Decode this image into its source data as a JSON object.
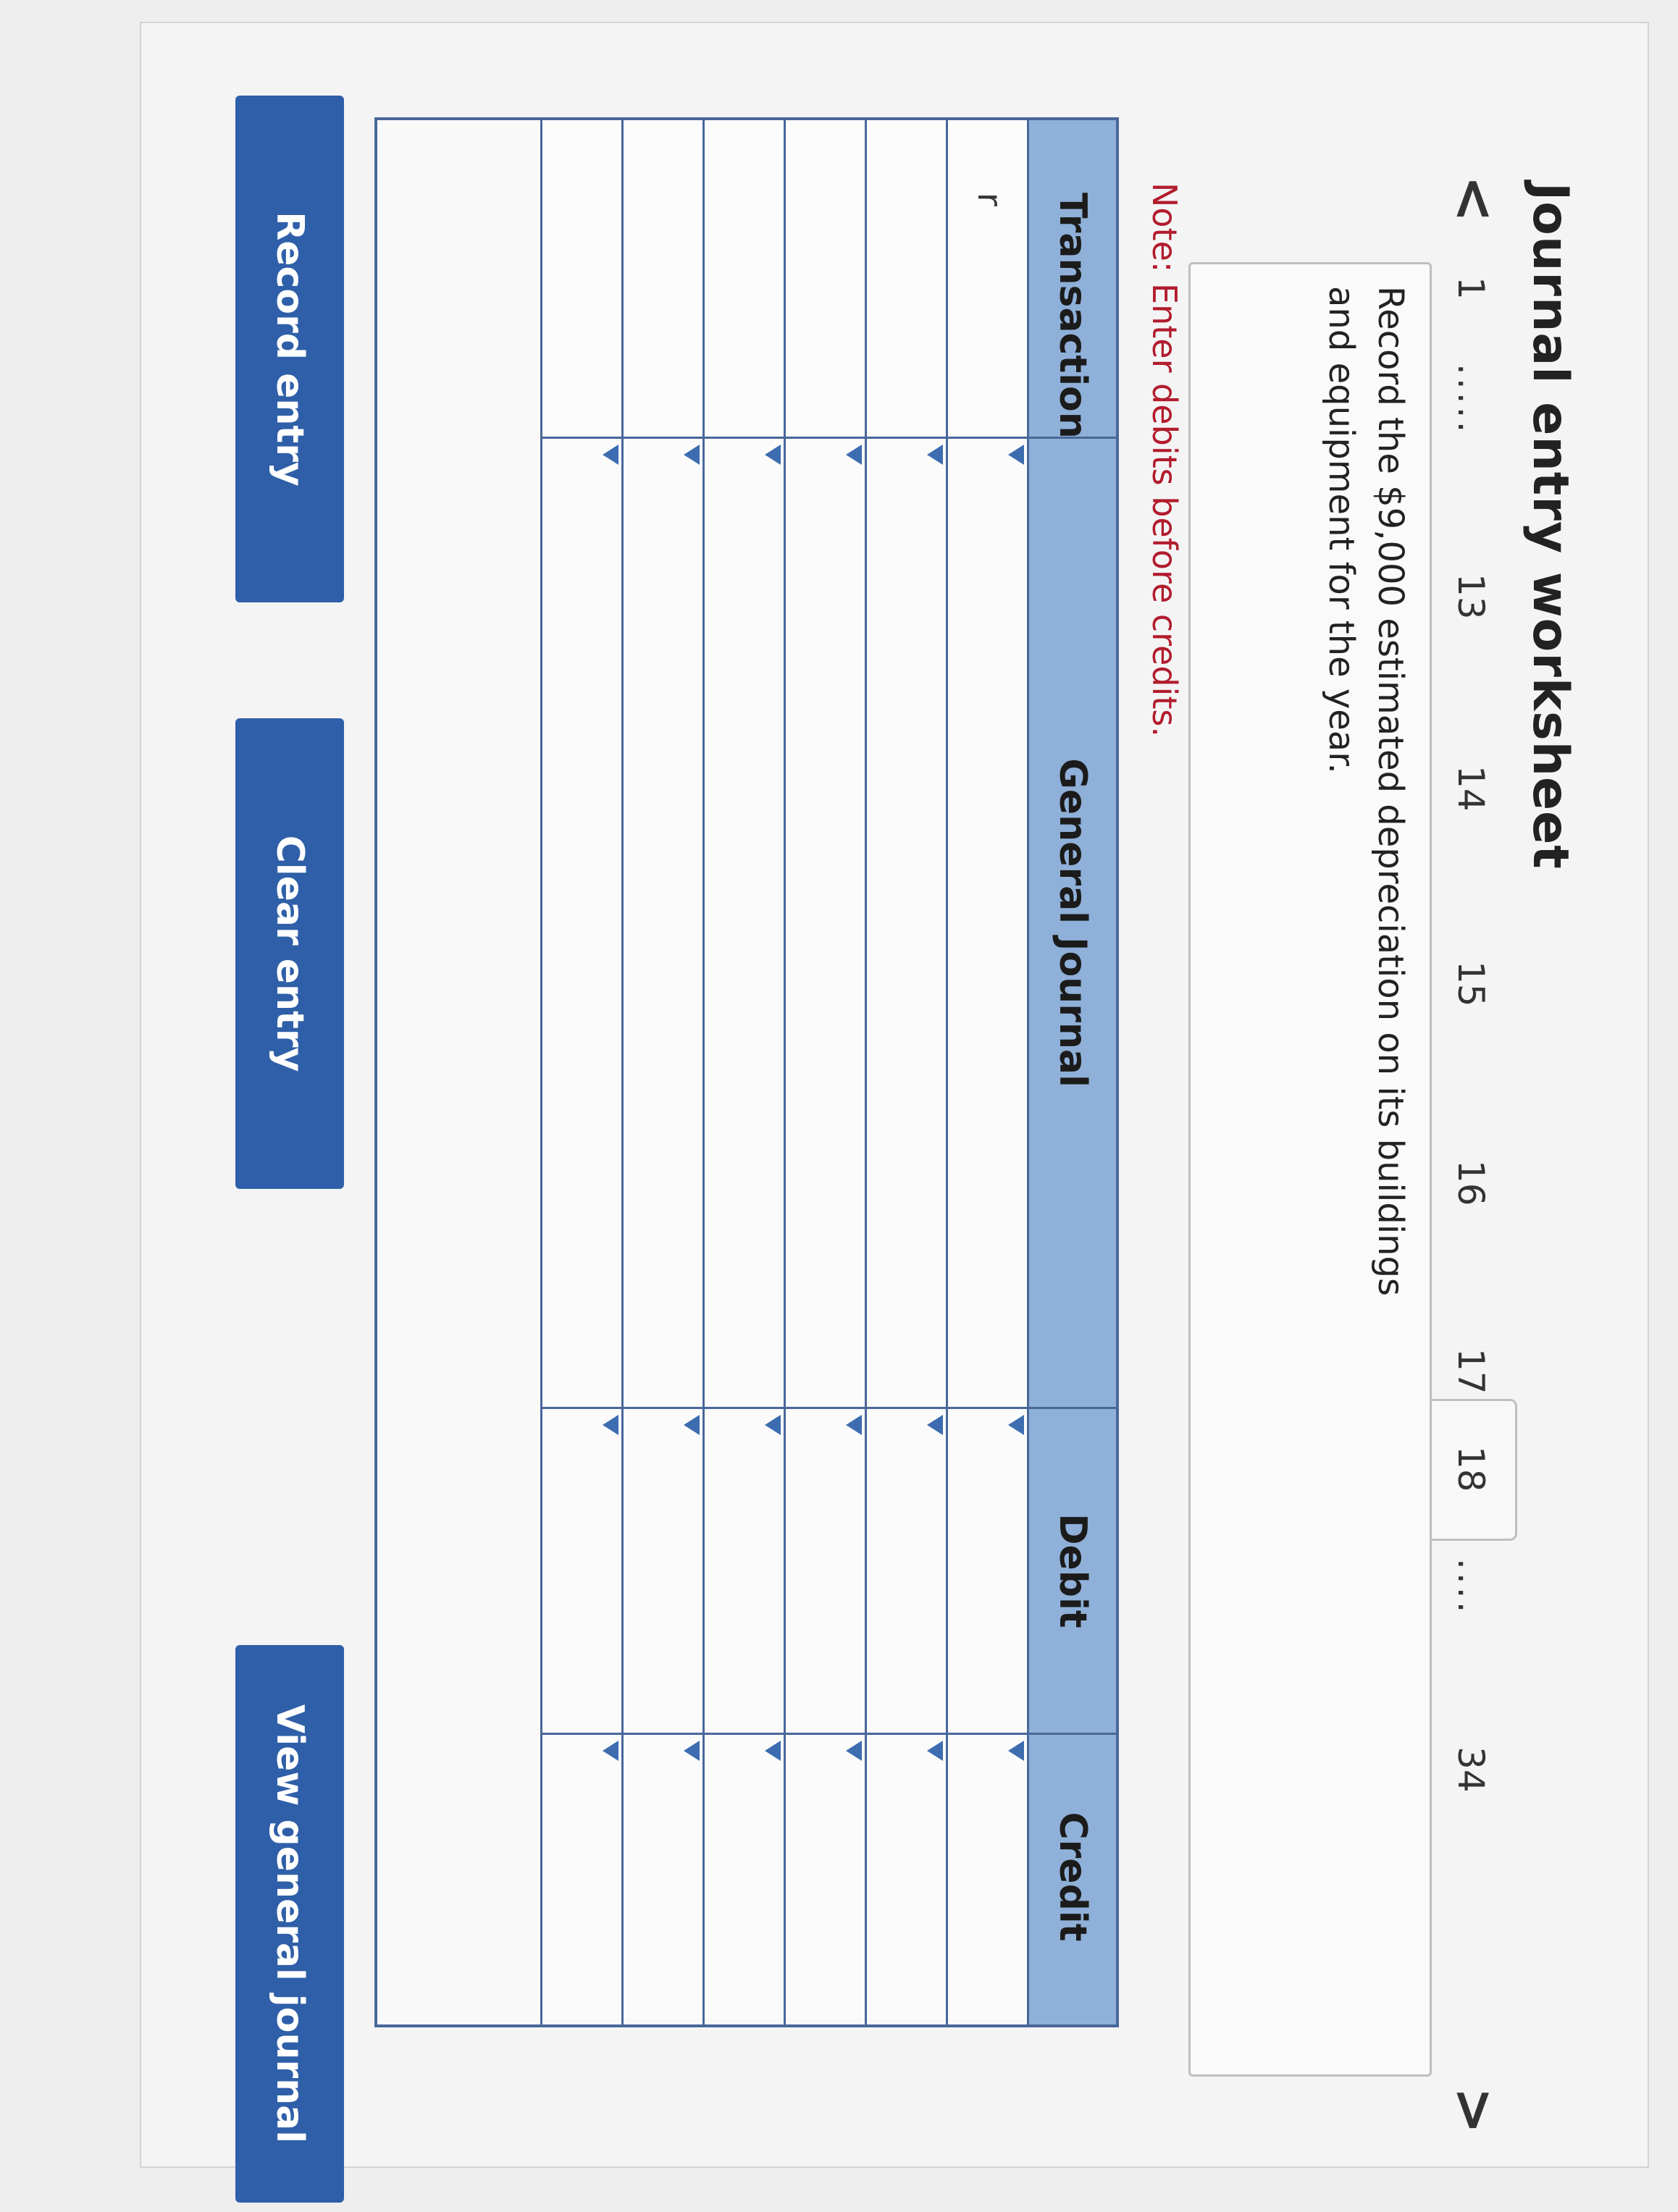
{
  "page": {
    "title": "Journal entry worksheet"
  },
  "pager": {
    "prev_icon": "chevron-left-icon",
    "next_icon": "chevron-right-icon",
    "prev_glyph": "<",
    "next_glyph": ">",
    "items": [
      "1",
      ".....",
      "13",
      "14",
      "15",
      "16",
      "17",
      "18",
      "....",
      "34"
    ],
    "active": "18"
  },
  "question": {
    "text": "Record the $9,000 estimated depreciation on its buildings and equipment for the year."
  },
  "note": {
    "text": "Note: Enter debits before credits."
  },
  "journal": {
    "headers": {
      "transaction": "Transaction",
      "general_journal": "General Journal",
      "debit": "Debit",
      "credit": "Credit"
    },
    "rows": [
      {
        "transaction": "r",
        "account": "",
        "debit": "",
        "credit": ""
      },
      {
        "transaction": "",
        "account": "",
        "debit": "",
        "credit": ""
      },
      {
        "transaction": "",
        "account": "",
        "debit": "",
        "credit": ""
      },
      {
        "transaction": "",
        "account": "",
        "debit": "",
        "credit": ""
      },
      {
        "transaction": "",
        "account": "",
        "debit": "",
        "credit": ""
      },
      {
        "transaction": "",
        "account": "",
        "debit": "",
        "credit": ""
      }
    ]
  },
  "buttons": {
    "record": "Record entry",
    "clear": "Clear entry",
    "view": "View general journal"
  },
  "colors": {
    "header_bg": "#8fb0d8",
    "grid": "#49679a",
    "button": "#2f5fa8",
    "note": "#b11c2d"
  }
}
